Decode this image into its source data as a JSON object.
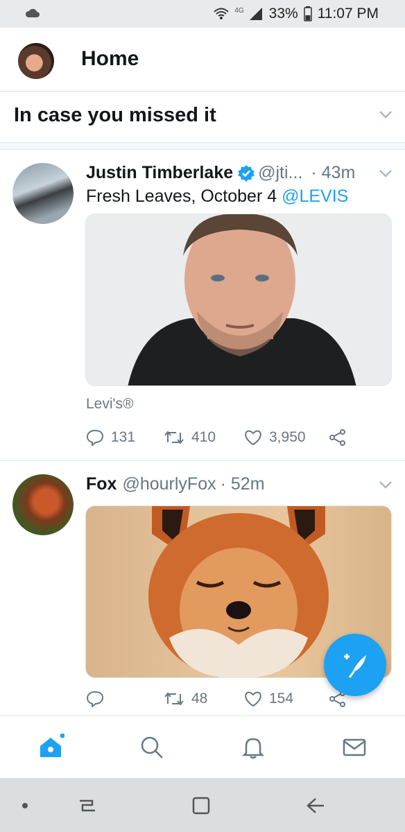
{
  "status_bar": {
    "network": "4G",
    "battery": "33%",
    "time": "11:07 PM"
  },
  "header": {
    "title": "Home"
  },
  "section": {
    "title": "In case you missed it"
  },
  "tweets": [
    {
      "name": "Justin Timberlake",
      "verified": true,
      "handle": "@jti...",
      "time": "· 43m",
      "text_plain": "Fresh Leaves, October 4 ",
      "text_mention": "@LEVIS",
      "caption": "Levi's®",
      "replies": "131",
      "retweets": "410",
      "likes": "3,950"
    },
    {
      "name": "Fox",
      "handle": "@hourlyFox",
      "time": "· 52m",
      "replies": "",
      "retweets": "48",
      "likes": "154"
    }
  ],
  "colors": {
    "accent": "#1da1f2",
    "secondary_text": "#657786",
    "border": "#e1e8ed"
  },
  "icons": {
    "fab": "compose-tweet-icon",
    "nav": [
      "home-icon",
      "search-icon",
      "bell-icon",
      "mail-icon"
    ]
  }
}
